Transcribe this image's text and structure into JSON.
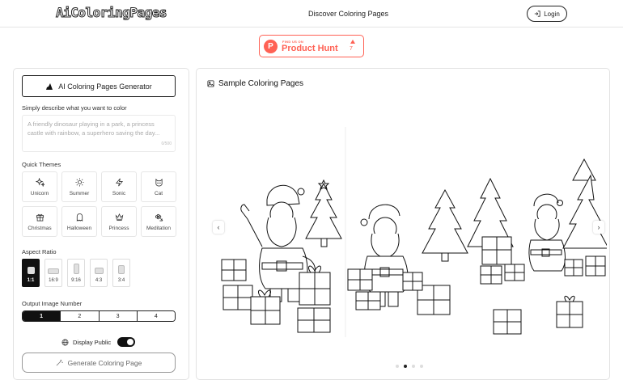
{
  "header": {
    "logo": "AiColoringPages",
    "nav_link": "Discover Coloring Pages",
    "login": "Login"
  },
  "product_hunt": {
    "small": "FIND US ON",
    "name": "Product Hunt",
    "votes": "7",
    "letter": "P"
  },
  "generator": {
    "title": "AI Coloring Pages Generator",
    "describe_label": "Simply describe what you want to color",
    "placeholder": "A friendly dinosaur playing in a park, a princess castle with rainbow, a superhero saving the day...",
    "counter": "0/500",
    "themes_label": "Quick Themes",
    "themes": [
      {
        "label": "Unicorn",
        "icon": "sparkles-icon"
      },
      {
        "label": "Summer",
        "icon": "sun-icon"
      },
      {
        "label": "Sonic",
        "icon": "lightning-icon"
      },
      {
        "label": "Cat",
        "icon": "cat-icon"
      },
      {
        "label": "Christmas",
        "icon": "gift-icon"
      },
      {
        "label": "Halloween",
        "icon": "ghost-icon"
      },
      {
        "label": "Princess",
        "icon": "crown-icon"
      },
      {
        "label": "Meditation",
        "icon": "flower-icon"
      }
    ],
    "aspect_label": "Aspect Ratio",
    "aspect_ratios": [
      "1:1",
      "16:9",
      "9:16",
      "4:3",
      "3:4"
    ],
    "aspect_selected": "1:1",
    "output_label": "Output Image Number",
    "output_numbers": [
      "1",
      "2",
      "3",
      "4"
    ],
    "output_selected": "1",
    "display_public": "Display Public",
    "display_public_on": true,
    "generate": "Generate Coloring Page"
  },
  "samples": {
    "title": "Sample Coloring Pages",
    "prev": "‹",
    "next": "›",
    "slide_count": 4,
    "active_slide": 1
  },
  "colors": {
    "accent": "#111111",
    "product_hunt": "#ff6154",
    "border": "#e2e2e2"
  }
}
